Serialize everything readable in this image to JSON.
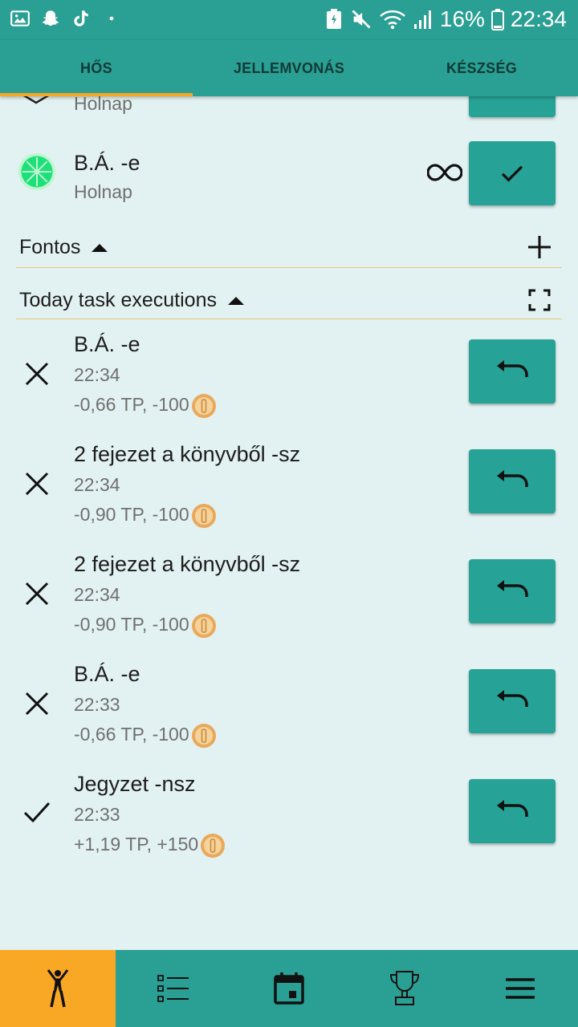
{
  "status_bar": {
    "battery_percent": "16%",
    "time": "22:34"
  },
  "tabs": [
    {
      "label": "HŐS",
      "active": true
    },
    {
      "label": "JELLEMVONÁS",
      "active": false
    },
    {
      "label": "KÉSZSÉG",
      "active": false
    }
  ],
  "habits": [
    {
      "title": "",
      "subtitle": "Holnap"
    },
    {
      "title": "B.Á. -e",
      "subtitle": "Holnap",
      "repeat_icon": "infinity-icon"
    }
  ],
  "sections": {
    "important": {
      "label": "Fontos"
    },
    "today": {
      "label": "Today task executions"
    }
  },
  "executions": [
    {
      "title": "B.Á. -e",
      "time": "22:34",
      "reward": "-0,66 TP, -100",
      "status": "failed"
    },
    {
      "title": "2 fejezet a könyvből -sz",
      "time": "22:34",
      "reward": "-0,90 TP, -100",
      "status": "failed"
    },
    {
      "title": "2 fejezet a könyvből -sz",
      "time": "22:34",
      "reward": "-0,90 TP, -100",
      "status": "failed"
    },
    {
      "title": "B.Á. -e",
      "time": "22:33",
      "reward": "-0,66 TP, -100",
      "status": "failed"
    },
    {
      "title": "Jegyzet -nsz",
      "time": "22:33",
      "reward": "+1,19 TP, +150",
      "status": "done"
    }
  ],
  "bottom_nav": [
    {
      "icon": "hero-icon",
      "active": true
    },
    {
      "icon": "task-list-icon",
      "active": false
    },
    {
      "icon": "calendar-icon",
      "active": false
    },
    {
      "icon": "trophy-icon",
      "active": false
    },
    {
      "icon": "menu-icon",
      "active": false
    }
  ],
  "colors": {
    "primary": "#2a9f93",
    "button": "#26a396",
    "accent": "#f9a825",
    "background": "#e2f1f1"
  }
}
